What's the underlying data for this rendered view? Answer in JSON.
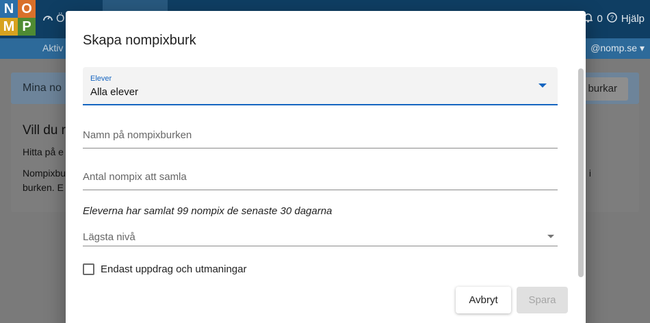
{
  "app": {
    "logo_letters": [
      "N",
      "O",
      "M",
      "P"
    ],
    "top_left_text": "Ö",
    "notifications_count": "0",
    "help_label": "Hjälp",
    "sub_left_text": "Aktiv",
    "account_text": "@nomp.se",
    "card_title": "Mina no",
    "card_button": "burkar",
    "heading": "Vill du r",
    "line1": "Hitta på e",
    "line2": "Nompixbu",
    "line3": "burken. E",
    "line2_end": "i",
    "colors": {
      "topbar": "#0f3e63",
      "subbar": "#2d6a9a"
    }
  },
  "dialog": {
    "title": "Skapa nompixburk",
    "students_select": {
      "label": "Elever",
      "value": "Alla elever"
    },
    "name_field": {
      "placeholder": "Namn på nompixburken"
    },
    "count_field": {
      "placeholder": "Antal nompix att samla"
    },
    "info_text": "Eleverna har samlat 99 nompix de senaste 30 dagarna",
    "level_select": {
      "placeholder": "Lägsta nivå"
    },
    "checkbox": {
      "label": "Endast uppdrag och utmaningar",
      "checked": false
    },
    "cancel_label": "Avbryt",
    "save_label": "Spara",
    "accent_color": "#1565c0"
  }
}
